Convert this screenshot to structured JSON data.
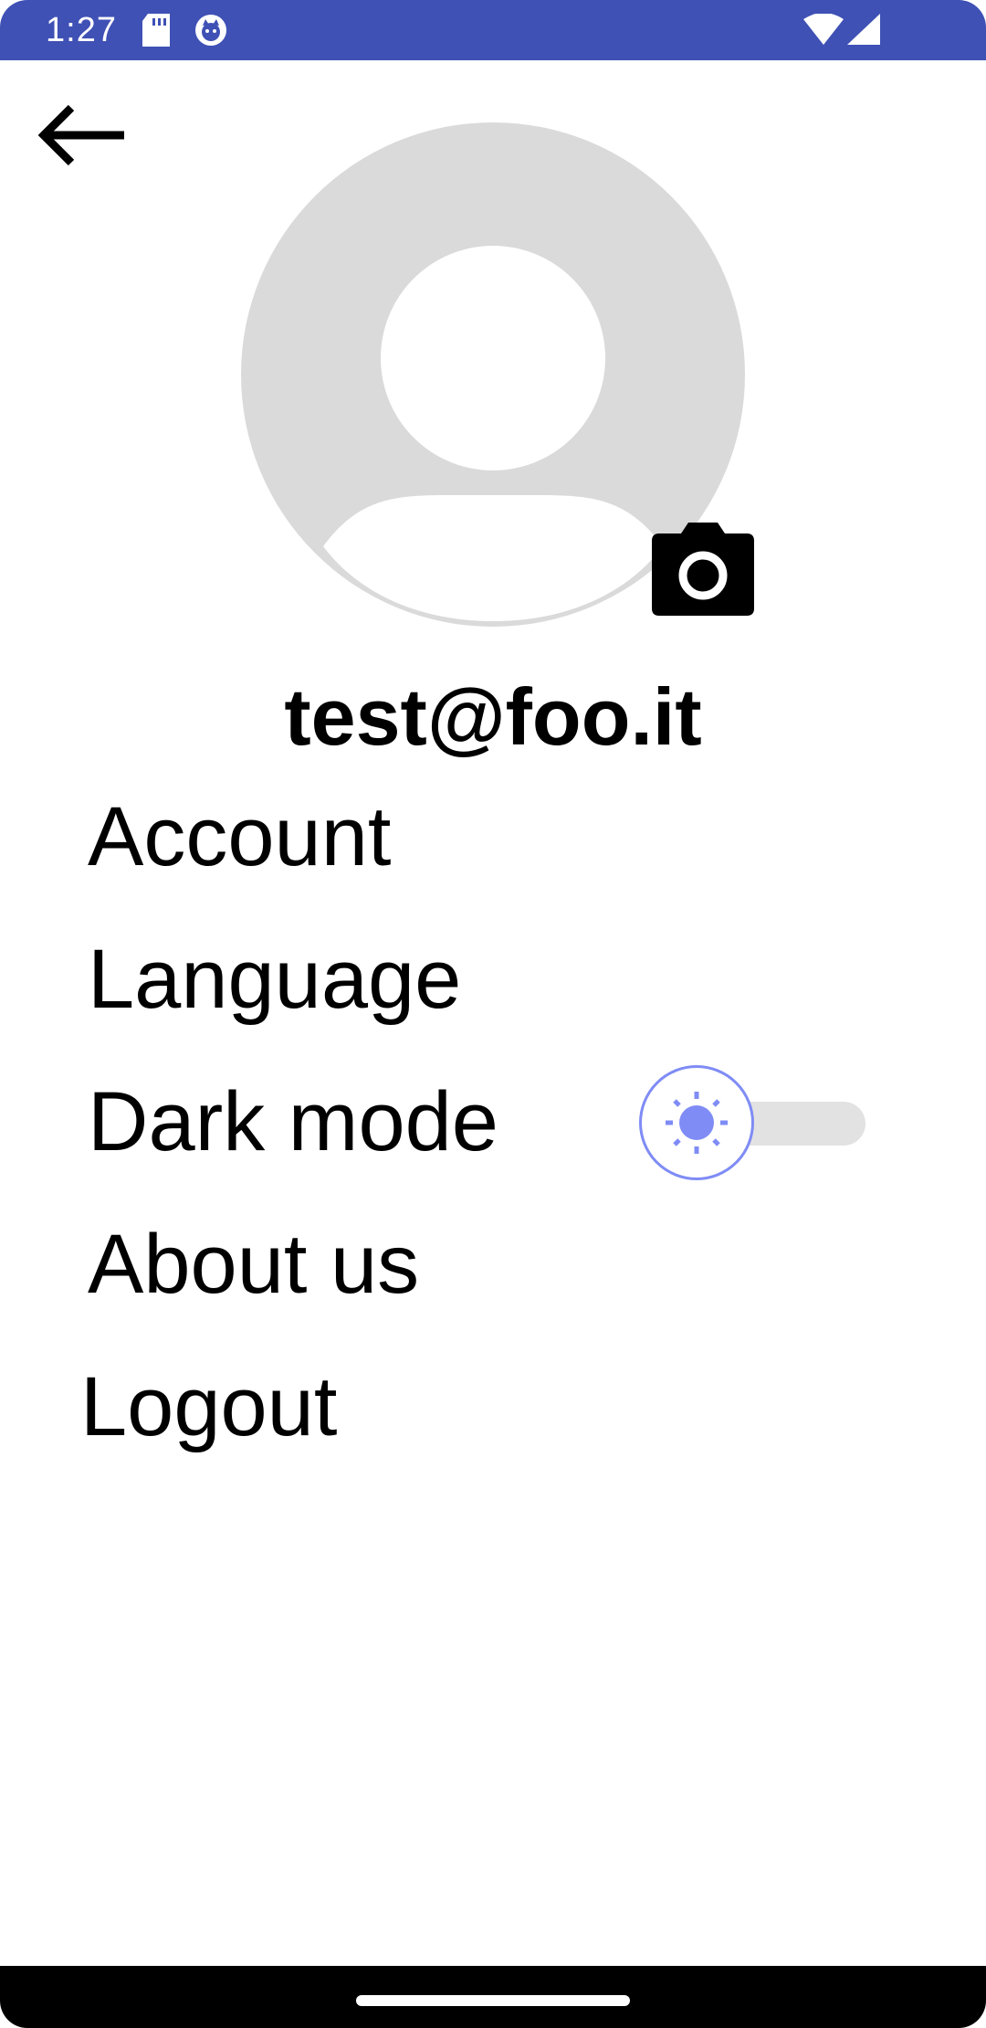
{
  "status_bar": {
    "time": "1:27",
    "background": "#3f51b5",
    "icons": [
      "sd-card-icon",
      "cat-notification-icon",
      "wifi-icon",
      "cellular-signal-icon"
    ]
  },
  "header": {
    "back_icon": "arrow-left-icon"
  },
  "profile": {
    "avatar_icon": "default-avatar-icon",
    "camera_icon": "camera-icon",
    "email": "test@foo.it"
  },
  "menu": {
    "account": "Account",
    "language": "Language",
    "dark_mode": "Dark mode",
    "about_us": "About us",
    "logout": "Logout"
  },
  "dark_mode_toggle": {
    "state": "off",
    "thumb_icon": "sun-icon",
    "accent": "#7f8cf5"
  },
  "nav_bar": {
    "home_indicator": "home-indicator"
  }
}
